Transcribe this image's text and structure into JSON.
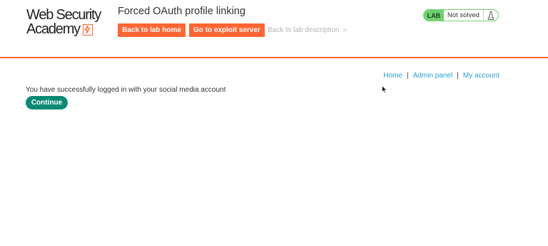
{
  "header": {
    "logo": {
      "line1": "Web Security",
      "line2": "Academy"
    },
    "lab_title": "Forced OAuth profile linking",
    "buttons": {
      "back_to_lab_home": "Back to lab home",
      "go_to_exploit_server": "Go to exploit server"
    },
    "description_link": "Back to lab description",
    "description_chevron": "»",
    "status": {
      "tag": "LAB",
      "text": "Not solved",
      "icon": "flask-icon"
    }
  },
  "nav": {
    "items": [
      "Home",
      "Admin panel",
      "My account"
    ],
    "separator": "|"
  },
  "main": {
    "message": "You have successfully logged in with your social media account",
    "continue_label": "Continue"
  },
  "colors": {
    "accent": "#ff6633",
    "status_green": "#70d16d",
    "continue_button": "#0a8a74",
    "link": "#29a0d8"
  }
}
